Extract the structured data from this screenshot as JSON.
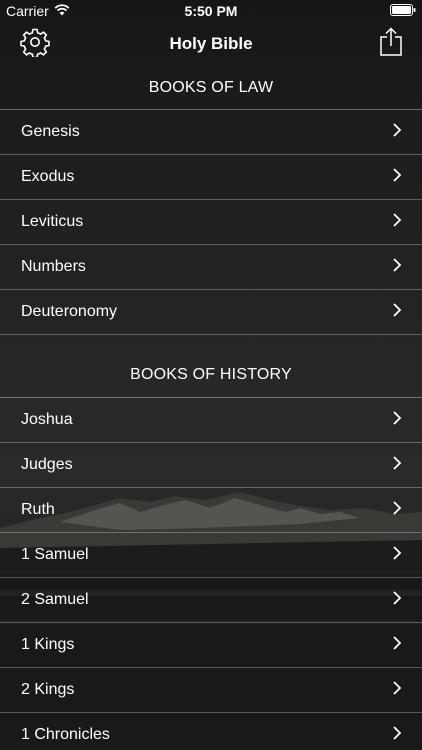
{
  "status_bar": {
    "carrier": "Carrier",
    "time": "5:50 PM",
    "wifi_icon": "wifi-icon",
    "battery_icon": "battery-icon"
  },
  "nav_bar": {
    "title": "Holy Bible",
    "settings_icon": "gear-icon",
    "share_icon": "share-icon"
  },
  "sections": [
    {
      "header": "BOOKS OF LAW",
      "books": [
        "Genesis",
        "Exodus",
        "Leviticus",
        "Numbers",
        "Deuteronomy"
      ]
    },
    {
      "header": "BOOKS OF HISTORY",
      "books": [
        "Joshua",
        "Judges",
        "Ruth",
        "1 Samuel",
        "2 Samuel",
        "1 Kings",
        "2 Kings",
        "1 Chronicles"
      ]
    }
  ],
  "colors": {
    "text": "#ffffff",
    "separator": "#5a5a5a",
    "background": "#1d1d1d"
  }
}
